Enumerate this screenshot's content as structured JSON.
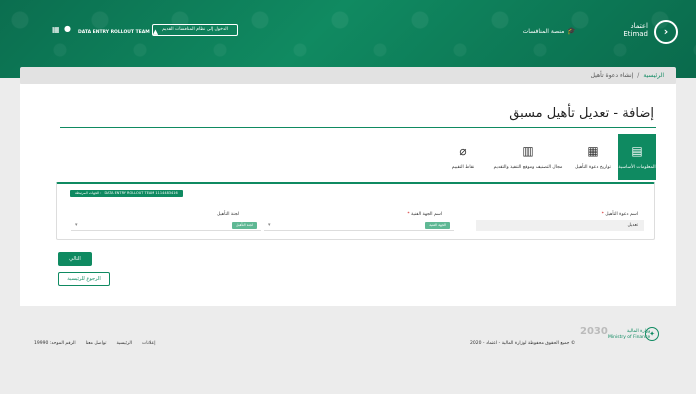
{
  "header": {
    "logo_text_ar": "اعتماد",
    "logo_text_en": "Etimad",
    "tenders_link": "منصة المنافسات",
    "user_name": "DATA ENTRY ROLLOUT TEAM",
    "old_system_button": "الدخول إلى نظام المنافسات القديم",
    "colors": {
      "primary": "#0f8a61"
    }
  },
  "breadcrumb": {
    "home": "الرئيسية",
    "separator": "/",
    "current": "إنشاء دعوة تأهيل"
  },
  "page": {
    "title": "إضافة - تعديل تأهيل مسبق"
  },
  "steps": [
    {
      "label": "المعلومات الأساسية",
      "icon": "document-icon",
      "active": true
    },
    {
      "label": "تواريخ دعوة التأهيل",
      "icon": "calendar-icon",
      "active": false
    },
    {
      "label": "مجال التصنيف وموقع التنفيذ والتقديم",
      "icon": "building-icon",
      "active": false
    },
    {
      "label": "نقاط التقييم",
      "icon": "paperclip-icon",
      "active": false
    }
  ],
  "form": {
    "status_badge": "DATA ENTRY ROLLOUT TEAM 1114483416",
    "status_badge_prefix": "الجهات المرتبطة :",
    "fields": {
      "name_label": "اسم دعوة التأهيل",
      "name_value": "تعديل",
      "agency_label": "اسم الجهة الفنية",
      "agency_button": "الجهة الفنية",
      "committee_label": "لجنة التأهيل",
      "committee_button": "لجنة التأهيل"
    }
  },
  "buttons": {
    "next": "التالي",
    "back": "الرجوع للرئيسية"
  },
  "footer": {
    "links": [
      "إعلانات",
      "الرئيسية",
      "تواصل معنا",
      "الرقم الموحد: 19990"
    ],
    "copyright": "© جميع الحقوق محفوظة لوزارة المالية - اعتماد - 2020",
    "vision": "2030",
    "ministry_name": "وزارة المالية",
    "ministry_en": "Ministry of Finance"
  }
}
